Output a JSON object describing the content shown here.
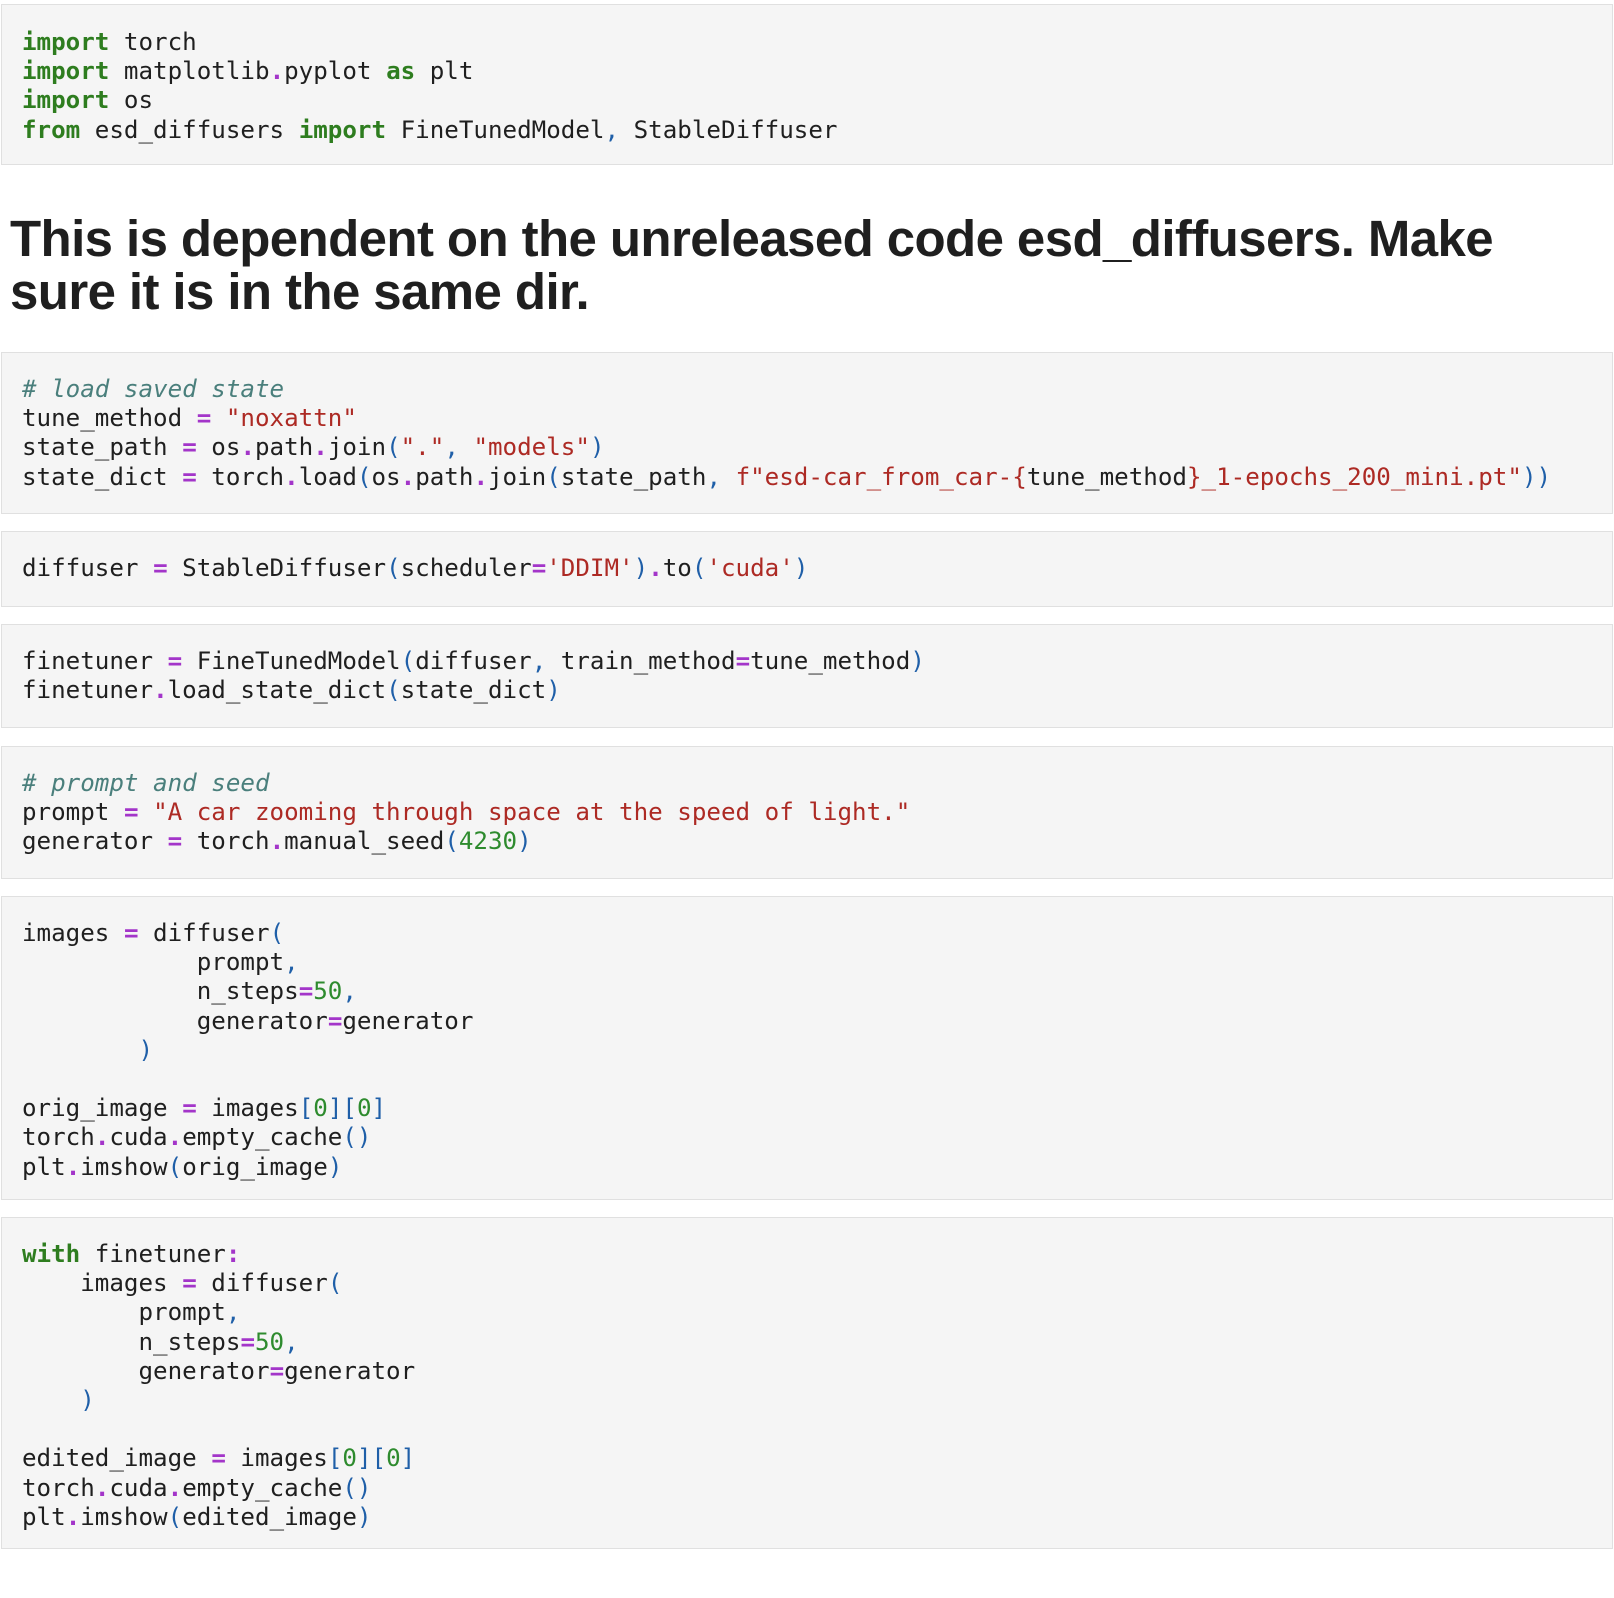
{
  "notebook": {
    "markdown_heading": "This is dependent on the unreleased code esd_diffusers. Make sure it is in the same dir.",
    "cells": [
      {
        "id": "imports",
        "lines": [
          [
            [
              "kw",
              "import"
            ],
            [
              "pl",
              " torch"
            ]
          ],
          [
            [
              "kw",
              "import"
            ],
            [
              "pl",
              " matplotlib"
            ],
            [
              "op",
              "."
            ],
            [
              "pl",
              "pyplot "
            ],
            [
              "kw",
              "as"
            ],
            [
              "pl",
              " plt"
            ]
          ],
          [
            [
              "kw",
              "import"
            ],
            [
              "pl",
              " os"
            ]
          ],
          [
            [
              "kw",
              "from"
            ],
            [
              "pl",
              " esd_diffusers "
            ],
            [
              "kw",
              "import"
            ],
            [
              "pl",
              " FineTunedModel"
            ],
            [
              "br",
              ","
            ],
            [
              "pl",
              " StableDiffuser"
            ]
          ]
        ]
      },
      {
        "id": "load-state",
        "lines": [
          [
            [
              "cm",
              "# load saved state"
            ]
          ],
          [
            [
              "pl",
              "tune_method "
            ],
            [
              "op",
              "="
            ],
            [
              "pl",
              " "
            ],
            [
              "str",
              "\"noxattn\""
            ]
          ],
          [
            [
              "pl",
              "state_path "
            ],
            [
              "op",
              "="
            ],
            [
              "pl",
              " os"
            ],
            [
              "op",
              "."
            ],
            [
              "pl",
              "path"
            ],
            [
              "op",
              "."
            ],
            [
              "pl",
              "join"
            ],
            [
              "br",
              "("
            ],
            [
              "str",
              "\".\""
            ],
            [
              "br",
              ","
            ],
            [
              "pl",
              " "
            ],
            [
              "str",
              "\"models\""
            ],
            [
              "br",
              ")"
            ]
          ],
          [
            [
              "pl",
              "state_dict "
            ],
            [
              "op",
              "="
            ],
            [
              "pl",
              " torch"
            ],
            [
              "op",
              "."
            ],
            [
              "pl",
              "load"
            ],
            [
              "br",
              "("
            ],
            [
              "pl",
              "os"
            ],
            [
              "op",
              "."
            ],
            [
              "pl",
              "path"
            ],
            [
              "op",
              "."
            ],
            [
              "pl",
              "join"
            ],
            [
              "br",
              "("
            ],
            [
              "pl",
              "state_path"
            ],
            [
              "br",
              ","
            ],
            [
              "pl",
              " "
            ],
            [
              "str",
              "f\"esd-car_from_car-{"
            ],
            [
              "pl",
              "tune_method"
            ],
            [
              "str",
              "}_1-epochs_200_mini.pt\""
            ],
            [
              "br",
              "))"
            ]
          ]
        ]
      },
      {
        "id": "diffuser",
        "lines": [
          [
            [
              "pl",
              "diffuser "
            ],
            [
              "op",
              "="
            ],
            [
              "pl",
              " StableDiffuser"
            ],
            [
              "br",
              "("
            ],
            [
              "pl",
              "scheduler"
            ],
            [
              "op",
              "="
            ],
            [
              "str",
              "'DDIM'"
            ],
            [
              "br",
              ")"
            ],
            [
              "op",
              "."
            ],
            [
              "pl",
              "to"
            ],
            [
              "br",
              "("
            ],
            [
              "str",
              "'cuda'"
            ],
            [
              "br",
              ")"
            ]
          ]
        ]
      },
      {
        "id": "finetuner",
        "lines": [
          [
            [
              "pl",
              "finetuner "
            ],
            [
              "op",
              "="
            ],
            [
              "pl",
              " FineTunedModel"
            ],
            [
              "br",
              "("
            ],
            [
              "pl",
              "diffuser"
            ],
            [
              "br",
              ","
            ],
            [
              "pl",
              " train_method"
            ],
            [
              "op",
              "="
            ],
            [
              "pl",
              "tune_method"
            ],
            [
              "br",
              ")"
            ]
          ],
          [
            [
              "pl",
              "finetuner"
            ],
            [
              "op",
              "."
            ],
            [
              "pl",
              "load_state_dict"
            ],
            [
              "br",
              "("
            ],
            [
              "pl",
              "state_dict"
            ],
            [
              "br",
              ")"
            ]
          ]
        ]
      },
      {
        "id": "prompt-seed",
        "lines": [
          [
            [
              "cm",
              "# prompt and seed"
            ]
          ],
          [
            [
              "pl",
              "prompt "
            ],
            [
              "op",
              "="
            ],
            [
              "pl",
              " "
            ],
            [
              "str",
              "\"A car zooming through space at the speed of light.\""
            ]
          ],
          [
            [
              "pl",
              "generator "
            ],
            [
              "op",
              "="
            ],
            [
              "pl",
              " torch"
            ],
            [
              "op",
              "."
            ],
            [
              "pl",
              "manual_seed"
            ],
            [
              "br",
              "("
            ],
            [
              "num",
              "4230"
            ],
            [
              "br",
              ")"
            ]
          ]
        ]
      },
      {
        "id": "orig-image",
        "lines": [
          [
            [
              "pl",
              "images "
            ],
            [
              "op",
              "="
            ],
            [
              "pl",
              " diffuser"
            ],
            [
              "br",
              "("
            ]
          ],
          [
            [
              "pl",
              "            prompt"
            ],
            [
              "br",
              ","
            ]
          ],
          [
            [
              "pl",
              "            n_steps"
            ],
            [
              "op",
              "="
            ],
            [
              "num",
              "50"
            ],
            [
              "br",
              ","
            ]
          ],
          [
            [
              "pl",
              "            generator"
            ],
            [
              "op",
              "="
            ],
            [
              "pl",
              "generator"
            ]
          ],
          [
            [
              "pl",
              "        "
            ],
            [
              "br",
              ")"
            ]
          ],
          [
            [
              "pl",
              ""
            ]
          ],
          [
            [
              "pl",
              "orig_image "
            ],
            [
              "op",
              "="
            ],
            [
              "pl",
              " images"
            ],
            [
              "br",
              "["
            ],
            [
              "num",
              "0"
            ],
            [
              "br",
              "]["
            ],
            [
              "num",
              "0"
            ],
            [
              "br",
              "]"
            ]
          ],
          [
            [
              "pl",
              "torch"
            ],
            [
              "op",
              "."
            ],
            [
              "pl",
              "cuda"
            ],
            [
              "op",
              "."
            ],
            [
              "pl",
              "empty_cache"
            ],
            [
              "br",
              "()"
            ]
          ],
          [
            [
              "pl",
              "plt"
            ],
            [
              "op",
              "."
            ],
            [
              "pl",
              "imshow"
            ],
            [
              "br",
              "("
            ],
            [
              "pl",
              "orig_image"
            ],
            [
              "br",
              ")"
            ]
          ]
        ]
      },
      {
        "id": "edited-image",
        "lines": [
          [
            [
              "kw",
              "with"
            ],
            [
              "pl",
              " finetuner"
            ],
            [
              "op",
              ":"
            ]
          ],
          [
            [
              "pl",
              "    images "
            ],
            [
              "op",
              "="
            ],
            [
              "pl",
              " diffuser"
            ],
            [
              "br",
              "("
            ]
          ],
          [
            [
              "pl",
              "        prompt"
            ],
            [
              "br",
              ","
            ]
          ],
          [
            [
              "pl",
              "        n_steps"
            ],
            [
              "op",
              "="
            ],
            [
              "num",
              "50"
            ],
            [
              "br",
              ","
            ]
          ],
          [
            [
              "pl",
              "        generator"
            ],
            [
              "op",
              "="
            ],
            [
              "pl",
              "generator"
            ]
          ],
          [
            [
              "pl",
              "    "
            ],
            [
              "br",
              ")"
            ]
          ],
          [
            [
              "pl",
              ""
            ]
          ],
          [
            [
              "pl",
              "edited_image "
            ],
            [
              "op",
              "="
            ],
            [
              "pl",
              " images"
            ],
            [
              "br",
              "["
            ],
            [
              "num",
              "0"
            ],
            [
              "br",
              "]["
            ],
            [
              "num",
              "0"
            ],
            [
              "br",
              "]"
            ]
          ],
          [
            [
              "pl",
              "torch"
            ],
            [
              "op",
              "."
            ],
            [
              "pl",
              "cuda"
            ],
            [
              "op",
              "."
            ],
            [
              "pl",
              "empty_cache"
            ],
            [
              "br",
              "()"
            ]
          ],
          [
            [
              "pl",
              "plt"
            ],
            [
              "op",
              "."
            ],
            [
              "pl",
              "imshow"
            ],
            [
              "br",
              "("
            ],
            [
              "pl",
              "edited_image"
            ],
            [
              "br",
              ")"
            ]
          ]
        ]
      }
    ]
  }
}
